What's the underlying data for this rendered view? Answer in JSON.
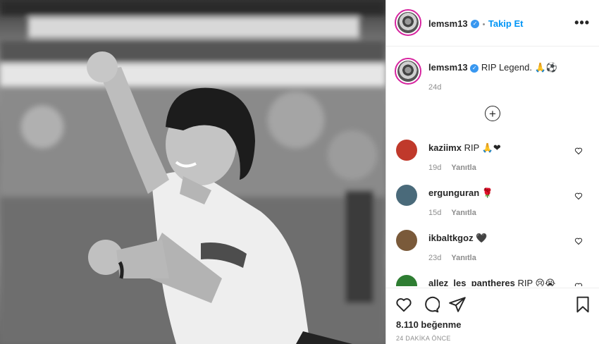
{
  "post": {
    "username": "lemsm13",
    "verified_glyph": "✓",
    "follow_separator": "•",
    "follow_label": "Takip Et",
    "more_label": "•••",
    "caption_text": "RIP Legend.",
    "caption_emojis": "🙏⚽",
    "caption_time": "24d",
    "load_more_label": "+"
  },
  "comments": [
    {
      "username": "kaziimx",
      "text": "RIP",
      "emoji": "🙏❤",
      "time": "19d",
      "reply_label": "Yanıtla",
      "avatar_color": "#c0392b"
    },
    {
      "username": "ergunguran",
      "text": "",
      "emoji": "🌹",
      "time": "15d",
      "reply_label": "Yanıtla",
      "avatar_color": "#4a6a7a"
    },
    {
      "username": "ikbaltkgoz",
      "text": "",
      "emoji": "🖤",
      "time": "23d",
      "reply_label": "Yanıtla",
      "avatar_color": "#7a5a3a"
    },
    {
      "username": "allez_les_pantheres",
      "text": "RIP",
      "emoji": "😢😭",
      "time": "",
      "reply_label": "",
      "avatar_color": "#2e7d32"
    }
  ],
  "footer": {
    "likes": "8.110 beğenme",
    "time_ago": "24 DAKİKA ÖNCE"
  },
  "icons": {
    "like": "heart-icon",
    "comment": "comment-bubble-icon",
    "share": "paper-plane-icon",
    "save": "bookmark-icon",
    "more": "more-options-icon",
    "add": "add-circle-icon"
  }
}
